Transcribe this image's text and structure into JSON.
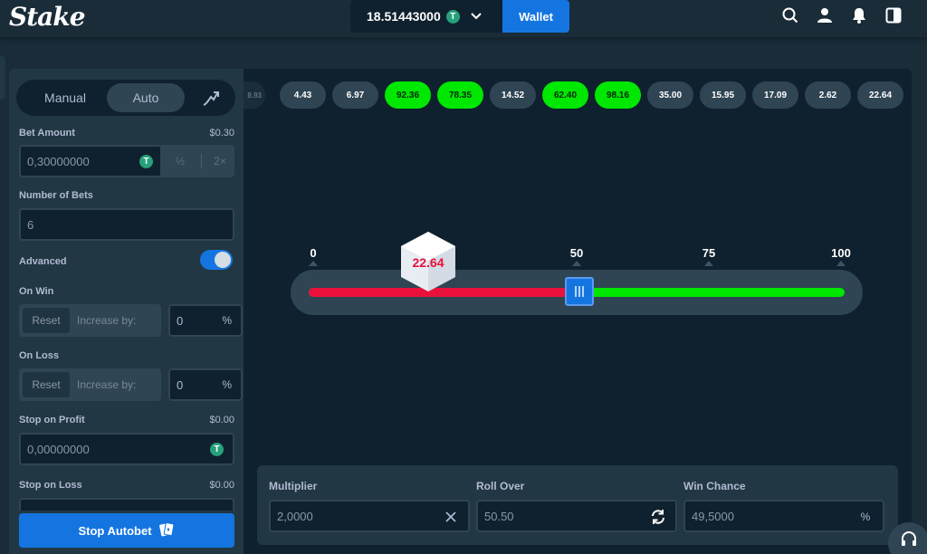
{
  "header": {
    "logo": "Stake",
    "balance": "18.51443000",
    "currency_icon": "tether-coin-icon",
    "wallet_label": "Wallet",
    "icons": [
      "search-icon",
      "user-icon",
      "bell-icon",
      "sidebar-toggle-icon"
    ]
  },
  "panel": {
    "mode_manual": "Manual",
    "mode_auto": "Auto",
    "bet_amount_label": "Bet Amount",
    "bet_amount_usd": "$0.30",
    "bet_amount_value": "0,30000000",
    "half_label": "½",
    "double_label": "2×",
    "number_of_bets_label": "Number of Bets",
    "number_of_bets_value": "6",
    "advanced_label": "Advanced",
    "advanced_on": true,
    "on_win_label": "On Win",
    "on_loss_label": "On Loss",
    "reset_label": "Reset",
    "increase_label": "Increase by:",
    "on_win_value": "0",
    "on_loss_value": "0",
    "percent_symbol": "%",
    "stop_profit_label": "Stop on Profit",
    "stop_profit_usd": "$0.00",
    "stop_profit_value": "0,00000000",
    "stop_loss_label": "Stop on Loss",
    "stop_loss_usd": "$0.00",
    "stop_autobet_label": "Stop Autobet"
  },
  "history": [
    {
      "value": "8.93",
      "win": false,
      "faded": true
    },
    {
      "value": "4.43",
      "win": false
    },
    {
      "value": "6.97",
      "win": false
    },
    {
      "value": "92.36",
      "win": true
    },
    {
      "value": "78.35",
      "win": true
    },
    {
      "value": "14.52",
      "win": false
    },
    {
      "value": "62.40",
      "win": true
    },
    {
      "value": "98.16",
      "win": true
    },
    {
      "value": "35.00",
      "win": false
    },
    {
      "value": "15.95",
      "win": false
    },
    {
      "value": "17.09",
      "win": false
    },
    {
      "value": "2.62",
      "win": false
    },
    {
      "value": "22.64",
      "win": false
    }
  ],
  "slider": {
    "scale_labels": [
      "0",
      "50",
      "75",
      "100"
    ],
    "roll_over": 50.5,
    "result": "22.64",
    "lose_color": "#e9113c",
    "win_color": "#00e701"
  },
  "stats": {
    "multiplier_label": "Multiplier",
    "multiplier_value": "2,0000",
    "roll_over_label": "Roll Over",
    "roll_over_value": "50.50",
    "win_chance_label": "Win Chance",
    "win_chance_value": "49,5000",
    "percent_symbol": "%"
  },
  "colors": {
    "accent": "#1475e1",
    "background": "#1a2c38",
    "panel": "#213743",
    "dark": "#0f212e"
  }
}
